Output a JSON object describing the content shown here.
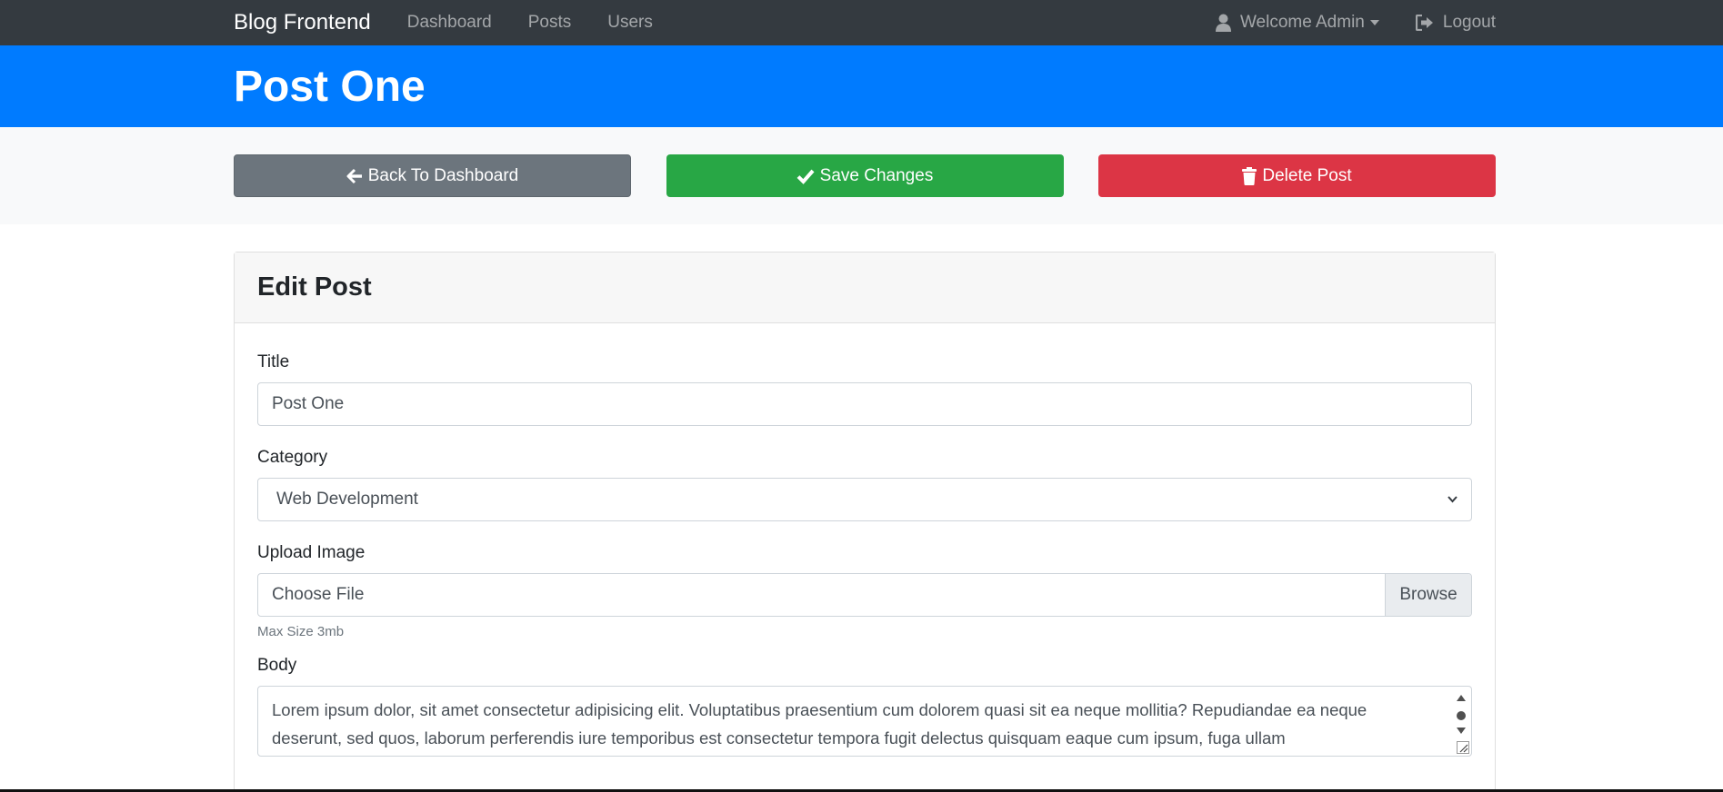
{
  "navbar": {
    "brand": "Blog Frontend",
    "links": [
      {
        "label": "Dashboard"
      },
      {
        "label": "Posts"
      },
      {
        "label": "Users"
      }
    ],
    "user_menu": {
      "label": "Welcome Admin",
      "icon": "user-icon"
    },
    "logout": {
      "label": "Logout",
      "icon": "logout-icon"
    }
  },
  "header": {
    "title": "Post One",
    "color": "#007bff"
  },
  "actions": {
    "back": {
      "label": "Back To Dashboard",
      "icon": "arrow-left-icon",
      "color": "#6c757d"
    },
    "save": {
      "label": "Save Changes",
      "icon": "check-icon",
      "color": "#28a745"
    },
    "delete": {
      "label": "Delete Post",
      "icon": "trash-icon",
      "color": "#dc3545"
    }
  },
  "card": {
    "title": "Edit Post",
    "fields": {
      "title": {
        "label": "Title",
        "value": "Post One"
      },
      "category": {
        "label": "Category",
        "selected": "Web Development"
      },
      "image": {
        "label": "Upload Image",
        "placeholder": "Choose File",
        "button": "Browse",
        "help": "Max Size 3mb"
      },
      "body": {
        "label": "Body",
        "value": "Lorem ipsum dolor, sit amet consectetur adipisicing elit. Voluptatibus praesentium cum dolorem quasi sit ea neque mollitia? Repudiandae ea neque deserunt, sed quos, laborum perferendis iure temporibus est consectetur tempora fugit delectus quisquam eaque cum ipsum, fuga ullam"
      }
    }
  }
}
